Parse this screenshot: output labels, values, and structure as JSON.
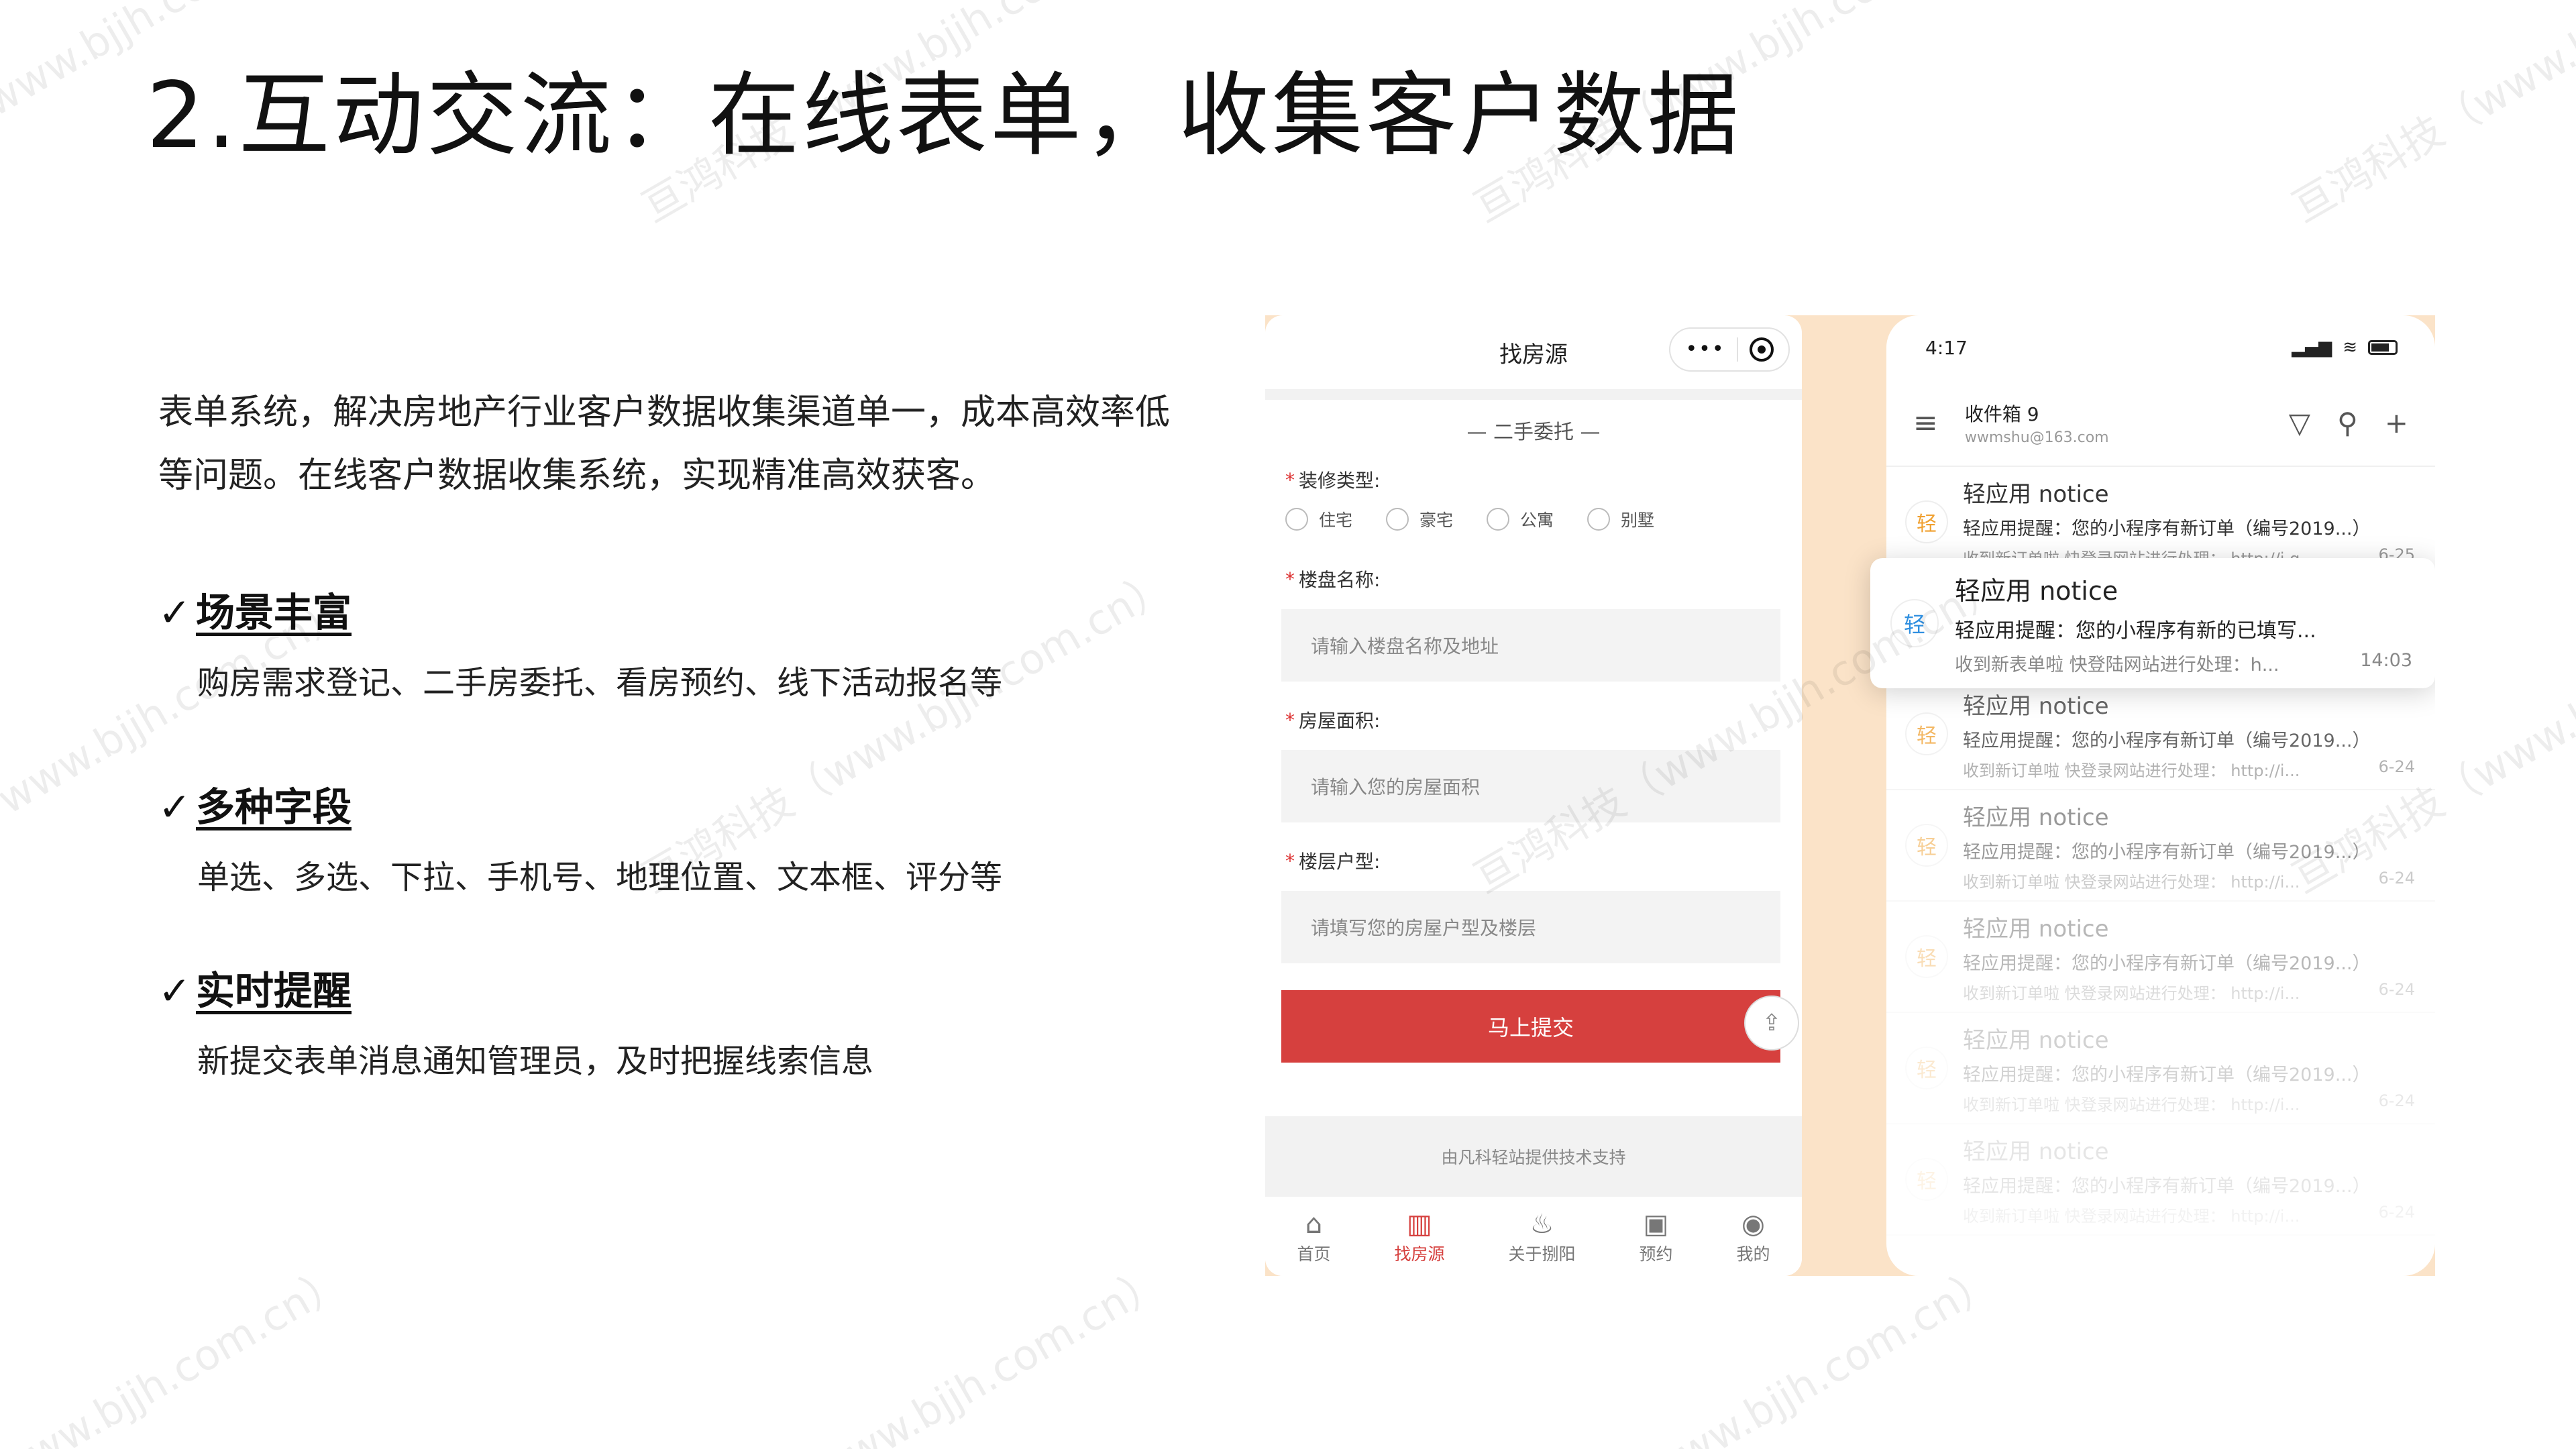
{
  "slide": {
    "title": "2.互动交流：在线表单，收集客户数据",
    "intro_line1": "表单系统，解决房地产行业客户数据收集渠道单一，成本高效率低",
    "intro_line2": "等问题。在线客户数据收集系统，实现精准高效获客。",
    "check_mark": "✓",
    "features": [
      {
        "title": "场景丰富",
        "desc": "购房需求登记、二手房委托、看房预约、线下活动报名等"
      },
      {
        "title": "多种字段",
        "desc": "单选、多选、下拉、手机号、地理位置、文本框、评分等"
      },
      {
        "title": "实时提醒",
        "desc": "新提交表单消息通知管理员，及时把握线索信息"
      }
    ]
  },
  "form_app": {
    "nav_title": "找房源",
    "capsule_dots": "•••",
    "section_title": "— 二手委托 —",
    "required_mark": "*",
    "decoration_label": "装修类型:",
    "decoration_options": [
      "住宅",
      "豪宅",
      "公寓",
      "别墅"
    ],
    "building_label": "楼盘名称:",
    "building_placeholder": "请输入楼盘名称及地址",
    "area_label": "房屋面积:",
    "area_placeholder": "请输入您的房屋面积",
    "layout_label": "楼层户型:",
    "layout_placeholder": "请填写您的房屋户型及楼层",
    "submit_label": "马上提交",
    "footer_text": "由凡科轻站提供技术支持",
    "tabs": [
      {
        "label": "首页",
        "icon": "⌂"
      },
      {
        "label": "找房源",
        "icon": "▥"
      },
      {
        "label": "关于捌阳",
        "icon": "♨"
      },
      {
        "label": "预约",
        "icon": "▣"
      },
      {
        "label": "我的",
        "icon": "◉"
      }
    ]
  },
  "mail_app": {
    "time": "4:17",
    "signal": "▂▄▆",
    "wifi": "≋",
    "inbox_title": "收件箱 9",
    "inbox_account": "wwmshu@163.com",
    "menu_icon": "≡",
    "filter_icon": "▽",
    "search_icon": "⚲",
    "add_icon": "+",
    "popup": {
      "avatar": "轻",
      "sender": "轻应用 notice",
      "subject": "轻应用提醒：您的小程序有新的已填写...",
      "preview": "收到新表单啦 快登陆网站进行处理：h...",
      "time": "14:03"
    },
    "mails": [
      {
        "avatar": "轻",
        "sender": "轻应用 notice",
        "subject": "轻应用提醒：您的小程序有新订单（编号2019...）",
        "preview": "收到新订单啦 快登录网站进行处理： http://i.q...",
        "date": "6-25"
      },
      {
        "avatar": "轻",
        "sender": "轻应用 notice",
        "subject": "轻应用提醒：您的小程序有新订单（编号2019...）",
        "preview": "收到新订单啦 快登录网站进行处理： http://i...",
        "date": "6-24"
      },
      {
        "avatar": "轻",
        "sender": "轻应用 notice",
        "subject": "轻应用提醒：您的小程序有新订单（编号2019...）",
        "preview": "收到新订单啦 快登录网站进行处理： http://i...",
        "date": "6-24"
      },
      {
        "avatar": "轻",
        "sender": "轻应用 notice",
        "subject": "轻应用提醒：您的小程序有新订单（编号2019...）",
        "preview": "收到新订单啦 快登录网站进行处理： http://i...",
        "date": "6-24"
      },
      {
        "avatar": "轻",
        "sender": "轻应用 notice",
        "subject": "轻应用提醒：您的小程序有新订单（编号2019...）",
        "preview": "收到新订单啦 快登录网站进行处理： http://i...",
        "date": "6-24"
      },
      {
        "avatar": "轻",
        "sender": "轻应用 notice",
        "subject": "轻应用提醒：您的小程序有新订单（编号2019...）",
        "preview": "收到新订单啦 快登录网站进行处理： http://i...",
        "date": "6-24"
      }
    ]
  },
  "watermarks": {
    "brand": "亘鸿科技（www.bjjh.com.cn）",
    "url": "www.bjjh.com.cn）"
  },
  "colors": {
    "accent_red": "#d6403e",
    "composite_bg": "#fbe3c8",
    "notice_avatar": "#f0a030",
    "popup_avatar": "#2f8fe0"
  }
}
